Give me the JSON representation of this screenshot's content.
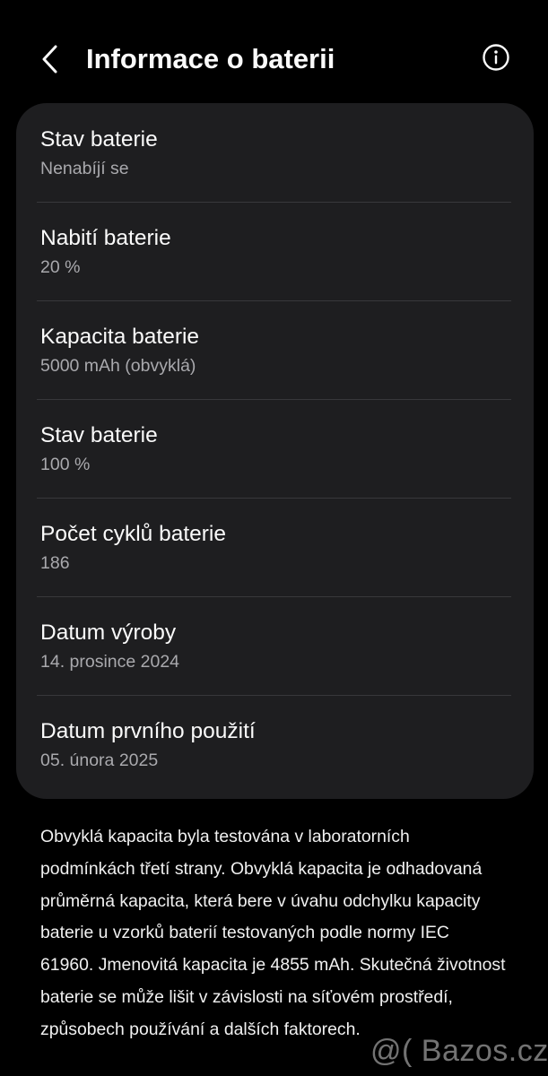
{
  "header": {
    "title": "Informace o baterii",
    "back_icon": "chevron-left-icon",
    "info_icon": "info-circle-icon"
  },
  "battery_items": [
    {
      "title": "Stav baterie",
      "value": "Nenabíjí se"
    },
    {
      "title": "Nabití baterie",
      "value": "20 %"
    },
    {
      "title": "Kapacita baterie",
      "value": "5000 mAh (obvyklá)"
    },
    {
      "title": "Stav baterie",
      "value": "100 %"
    },
    {
      "title": "Počet cyklů baterie",
      "value": "186"
    },
    {
      "title": "Datum výroby",
      "value": "14. prosince 2024"
    },
    {
      "title": "Datum prvního použití",
      "value": "05. února 2025"
    }
  ],
  "description": "Obvyklá kapacita byla testována v laboratorních podmínkách třetí strany. Obvyklá kapacita je odhadovaná průměrná kapacita, která bere v úvahu odchylku kapacity baterie u vzorků baterií testovaných podle normy IEC 61960. Jmenovitá kapacita je 4855 mAh. Skutečná životnost baterie se může lišit v závislosti na síťovém prostředí, způsobech používání a dalších faktorech.",
  "watermark": "@( Bazos.cz",
  "colors": {
    "background": "#000000",
    "card": "#1e1e20",
    "primary_text": "#fafafa",
    "secondary_text": "#a9a9ad",
    "divider": "#38383b"
  }
}
